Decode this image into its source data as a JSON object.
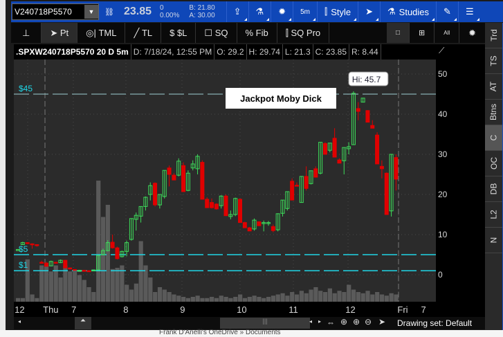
{
  "toolbar": {
    "symbol": "V240718P5570",
    "price": "23.85",
    "change": "0",
    "change_pct": "0.00%",
    "bid": "B: 21.80",
    "ask": "A: 30.00",
    "timeframe": "5m",
    "style": "Style",
    "studies": "Studies"
  },
  "drawing_tools": [
    {
      "label": ""
    },
    {
      "label": "Pt"
    },
    {
      "label": "TML"
    },
    {
      "label": "TL"
    },
    {
      "label": "$L"
    },
    {
      "label": "SQ"
    },
    {
      "label": "Fib"
    },
    {
      "label": "SQ Pro"
    }
  ],
  "layout_buttons": {
    "all": "All"
  },
  "info": {
    "title": ".SPXW240718P5570 20 D 5m",
    "date": "D: 7/18/24, 12:55 PM",
    "open": "O: 29.2",
    "high": "H: 29.74",
    "low": "L: 21.3",
    "close": "C: 23.85",
    "range": "R: 8.44"
  },
  "right_tabs": [
    "Trd",
    "TS",
    "AT",
    "Btns",
    "C",
    "OC",
    "DB",
    "L2",
    "N"
  ],
  "selected_tab": "C",
  "scroll": {
    "drawing_set": "Drawing set: Default"
  },
  "bottom": {
    "path": "Frank D'Anelli's OneDrive » Documents"
  },
  "colors": {
    "up": "#3ddc5a",
    "down": "#e00000",
    "level": "#1fd6e6",
    "volume": "#5a5a5a",
    "grid": "#4a4a4a"
  },
  "chart_data": {
    "type": "candlestick",
    "ylim": [
      -4,
      56
    ],
    "y_ticks": [
      "50",
      "40",
      "30",
      "20",
      "10",
      "0"
    ],
    "y_tick_values": [
      50,
      40,
      30,
      20,
      10,
      0
    ],
    "x_labels": [
      {
        "label": "12",
        "i": 0
      },
      {
        "label": "Thu",
        "i": 6
      },
      {
        "label": "7",
        "i": 12
      },
      {
        "label": "8",
        "i": 23
      },
      {
        "label": "9",
        "i": 35
      },
      {
        "label": "10",
        "i": 47
      },
      {
        "label": "11",
        "i": 58
      },
      {
        "label": "12",
        "i": 70
      },
      {
        "label": "Fri",
        "i": 81
      },
      {
        "label": "7",
        "i": 86
      }
    ],
    "levels": [
      {
        "label": "$45",
        "value": 45
      },
      {
        "label": "$5",
        "value": 5
      },
      {
        "label": "$1",
        "value": 1
      }
    ],
    "annotation": "Jackpot Moby Dick",
    "high_bubble": "Hi: 45.7",
    "ohlc": [
      [
        6,
        6.4,
        6,
        6.3
      ],
      [
        7.5,
        8.2,
        7.4,
        8
      ],
      [
        8,
        8.1,
        7.6,
        7.8
      ],
      [
        7.7,
        7.8,
        6.5,
        7.5
      ],
      [
        7.5,
        7.6,
        7,
        7.3
      ],
      [
        3.1,
        3.5,
        2.8,
        2.9
      ],
      [
        2.9,
        3.2,
        2,
        2.1
      ],
      [
        2.2,
        3.5,
        2.1,
        3.3
      ],
      [
        3.1,
        3.2,
        2.9,
        3
      ],
      [
        3,
        3.8,
        2.9,
        3.6
      ],
      [
        3.6,
        3.7,
        1.6,
        1.7
      ],
      [
        1.7,
        1.8,
        1.3,
        1.5
      ],
      [
        1.3,
        1.4,
        1,
        1.1
      ],
      [
        1,
        1.2,
        0.9,
        1.1
      ],
      [
        1.1,
        1.2,
        0.9,
        1
      ],
      [
        1,
        1.1,
        0.8,
        0.9
      ],
      [
        1,
        1.3,
        0.9,
        1.2
      ],
      [
        1.2,
        4.9,
        1.1,
        4.8
      ],
      [
        5,
        6.5,
        4.8,
        6
      ],
      [
        6,
        8.6,
        5.8,
        8
      ],
      [
        8.1,
        10,
        6.5,
        6.7
      ],
      [
        6.7,
        7,
        3.8,
        4
      ],
      [
        4.5,
        6,
        4.3,
        5.8
      ],
      [
        5.8,
        8.5,
        4.6,
        8
      ],
      [
        8.8,
        14,
        8.5,
        14
      ],
      [
        13.8,
        15.5,
        11,
        14.8
      ],
      [
        14.6,
        17,
        13,
        17
      ],
      [
        17,
        19.5,
        16,
        19.3
      ],
      [
        20,
        23,
        18.5,
        22.2
      ],
      [
        22.8,
        23,
        17,
        17.4
      ],
      [
        17.4,
        20,
        16.5,
        20
      ],
      [
        19.5,
        26,
        19,
        26
      ],
      [
        26.6,
        27.2,
        22,
        25
      ],
      [
        24.8,
        25.3,
        23.6,
        23.6
      ],
      [
        24.8,
        29,
        24.5,
        28.3
      ],
      [
        27.2,
        28,
        20.7,
        20.7
      ],
      [
        21,
        26,
        20.8,
        25.3
      ],
      [
        26.6,
        28.5,
        26,
        27.6
      ],
      [
        26.4,
        30,
        25,
        29.5
      ],
      [
        28,
        28.5,
        18.8,
        18.8
      ],
      [
        18.8,
        19.3,
        16.7,
        16.7
      ],
      [
        18,
        19,
        16.5,
        16.7
      ],
      [
        17.6,
        17.8,
        16.2,
        16.4
      ],
      [
        17.2,
        19.8,
        16.5,
        19.6
      ],
      [
        19.6,
        20,
        14.7,
        14.7
      ],
      [
        14.5,
        16,
        13.8,
        15
      ],
      [
        15,
        19.2,
        14.6,
        19
      ],
      [
        18.8,
        19,
        13,
        13
      ],
      [
        13,
        13.2,
        11.7,
        11.7
      ],
      [
        11.7,
        11.9,
        10.9,
        10.9
      ],
      [
        11.4,
        14,
        11,
        13.6
      ],
      [
        13.2,
        13.3,
        12.2,
        12.2
      ],
      [
        12.9,
        13.5,
        10.8,
        13
      ],
      [
        12.8,
        13.4,
        12.2,
        13
      ],
      [
        12,
        12.5,
        10.6,
        11
      ],
      [
        11.2,
        15.3,
        10.8,
        15.2
      ],
      [
        15.3,
        18.6,
        14.5,
        18.6
      ],
      [
        16.5,
        20.7,
        16,
        20.7
      ],
      [
        23.3,
        24,
        18.6,
        18.6
      ],
      [
        22.3,
        23,
        22,
        22.2
      ],
      [
        18,
        24.5,
        18,
        24.5
      ],
      [
        24.5,
        27,
        21,
        21.5
      ],
      [
        22.7,
        25.9,
        22.5,
        25.9
      ],
      [
        26.4,
        27,
        24.3,
        24.3
      ],
      [
        25.3,
        33,
        25,
        33
      ],
      [
        32.7,
        33,
        30,
        30
      ],
      [
        31,
        32.8,
        30.5,
        32.8
      ],
      [
        34,
        36.5,
        29.3,
        29.3
      ],
      [
        28.6,
        29,
        27.8,
        27.8
      ],
      [
        28.4,
        31.7,
        25,
        31.7
      ],
      [
        31.4,
        33,
        30,
        31.9
      ],
      [
        32.4,
        45.7,
        32.4,
        45.2
      ],
      [
        41.4,
        43,
        38.5,
        40.7
      ],
      [
        43,
        44,
        43,
        44
      ],
      [
        40.9,
        41,
        38,
        38
      ],
      [
        37.2,
        38.5,
        36.5,
        36.5
      ],
      [
        34.8,
        35.5,
        27.6,
        27.6
      ],
      [
        27,
        28.5,
        24,
        26.4
      ],
      [
        25.3,
        25.5,
        15,
        15
      ],
      [
        15.9,
        30,
        14.5,
        30
      ],
      [
        29.2,
        30,
        21,
        23.8
      ]
    ],
    "volume": [
      3,
      3,
      35,
      6,
      3,
      30,
      30,
      25,
      30,
      20,
      30,
      25,
      25,
      22,
      18,
      12,
      8,
      100,
      70,
      80,
      27,
      28,
      30,
      14,
      10,
      15,
      50,
      30,
      20,
      8,
      12,
      10,
      8,
      6,
      5,
      4,
      3,
      4,
      5,
      3,
      3,
      4,
      3,
      5,
      4,
      3,
      4,
      6,
      3,
      4,
      5,
      4,
      3,
      4,
      5,
      6,
      7,
      5,
      8,
      6,
      9,
      7,
      10,
      12,
      9,
      8,
      11,
      7,
      9,
      8,
      14,
      10,
      8,
      7,
      9,
      6,
      8,
      6,
      5,
      7,
      6
    ]
  }
}
